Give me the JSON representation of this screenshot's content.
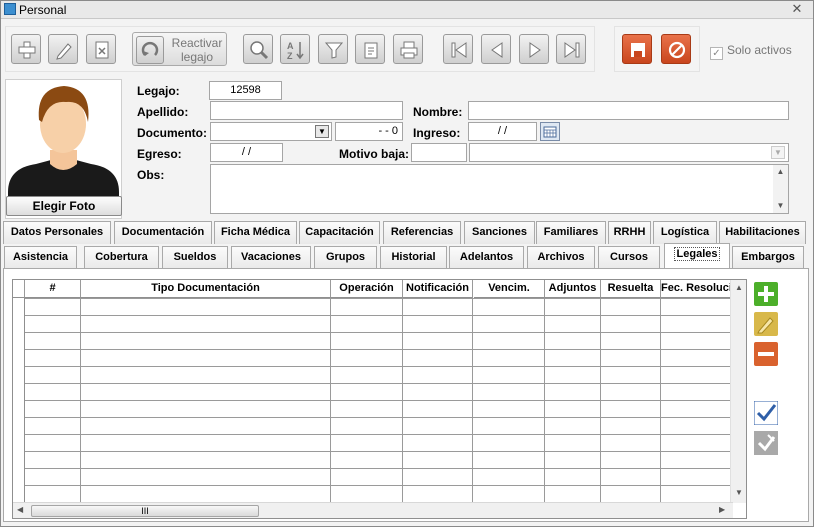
{
  "window": {
    "title": "Personal",
    "close_glyph": "✕"
  },
  "toolbar": {
    "reactivar_line1": "Reactivar",
    "reactivar_line2": "legajo",
    "solo_activos": "Solo activos",
    "solo_activos_checked": true
  },
  "photo": {
    "button": "Elegir Foto"
  },
  "form": {
    "legajo_label": "Legajo:",
    "legajo_value": "12598",
    "apellido_label": "Apellido:",
    "apellido_value": "",
    "nombre_label": "Nombre:",
    "nombre_value": "",
    "documento_label": "Documento:",
    "documento_type": "",
    "documento_number": "-   -  0",
    "ingreso_label": "Ingreso:",
    "ingreso_value": "/ /",
    "egreso_label": "Egreso:",
    "egreso_value": "/ /",
    "motivo_label": "Motivo baja:",
    "motivo_code": "",
    "motivo_desc": "",
    "obs_label": "Obs:",
    "obs_value": ""
  },
  "tabs_row1": [
    "Datos Personales",
    "Documentación",
    "Ficha Médica",
    "Capacitación",
    "Referencias",
    "Sanciones",
    "Familiares",
    "RRHH",
    "Logística",
    "Habilitaciones"
  ],
  "tabs_row2": [
    "Asistencia",
    "Cobertura",
    "Sueldos",
    "Vacaciones",
    "Grupos",
    "Historial",
    "Adelantos",
    "Archivos",
    "Cursos",
    "Legales",
    "Embargos"
  ],
  "active_tab": "Legales",
  "grid": {
    "columns": [
      "#",
      "Tipo Documentación",
      "Operación",
      "Notificación",
      "Vencim.",
      "Adjuntos",
      "Resuelta",
      "Fec. Resolución"
    ],
    "rows": []
  },
  "hscroll_grip": "III",
  "colors": {
    "accent_orange": "#d4532a",
    "add_green": "#4caf2a",
    "edit_yellow": "#d8b84a",
    "remove_orange": "#d9622e",
    "check_blue": "#2f5fa8"
  }
}
